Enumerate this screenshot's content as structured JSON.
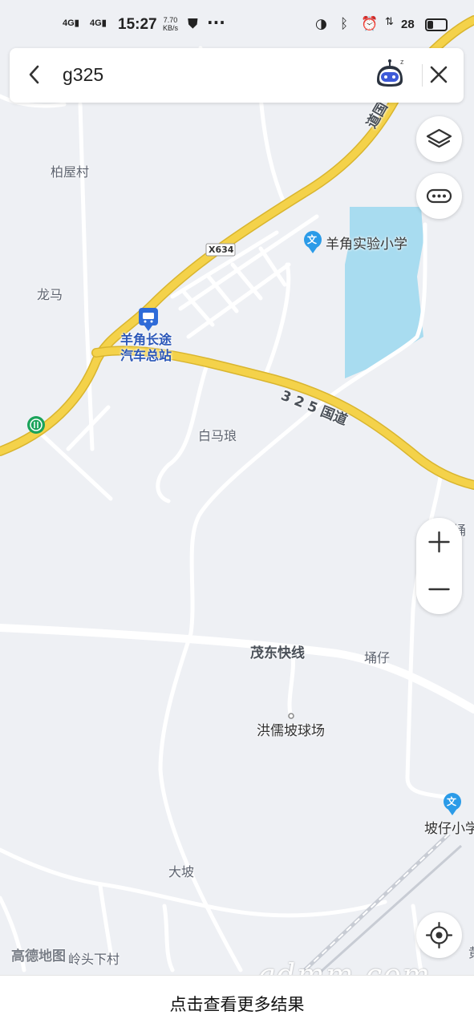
{
  "status_bar": {
    "network_1": "4G",
    "network_2": "4G",
    "time": "15:27",
    "speed_value": "7.70",
    "speed_unit": "KB/s",
    "more_dots": "···",
    "battery": "28"
  },
  "search": {
    "query": "g325"
  },
  "map": {
    "labels": {
      "village_baiwu": "柏屋村",
      "village_longma": "龙马",
      "road_x634": "X634",
      "school_yangjiao": "羊角实验小学",
      "station_line1": "羊角长途",
      "station_line2": "汽车总站",
      "road_325_a": "3 2 5 国道",
      "road_325_b": "道国",
      "place_baimalang": "白马琅",
      "road_maodong": "茂东快线",
      "place_yongzai": "埇仔",
      "place_tong": "埇",
      "place_hongru": "洪儒坡球场",
      "school_pozai": "坡仔小学",
      "place_dapo": "大坡",
      "place_lingtou": "岭头下村",
      "place_edge": "黄"
    },
    "brand": "高德地图",
    "watermark": "gdmm.com",
    "colors": {
      "background": "#eef0f4",
      "national_road": "#f4d24a",
      "minor_road": "#ffffff",
      "water": "#a8dcf0",
      "accent_blue": "#2a56b8"
    }
  },
  "bottom": {
    "more_results": "点击查看更多结果"
  }
}
